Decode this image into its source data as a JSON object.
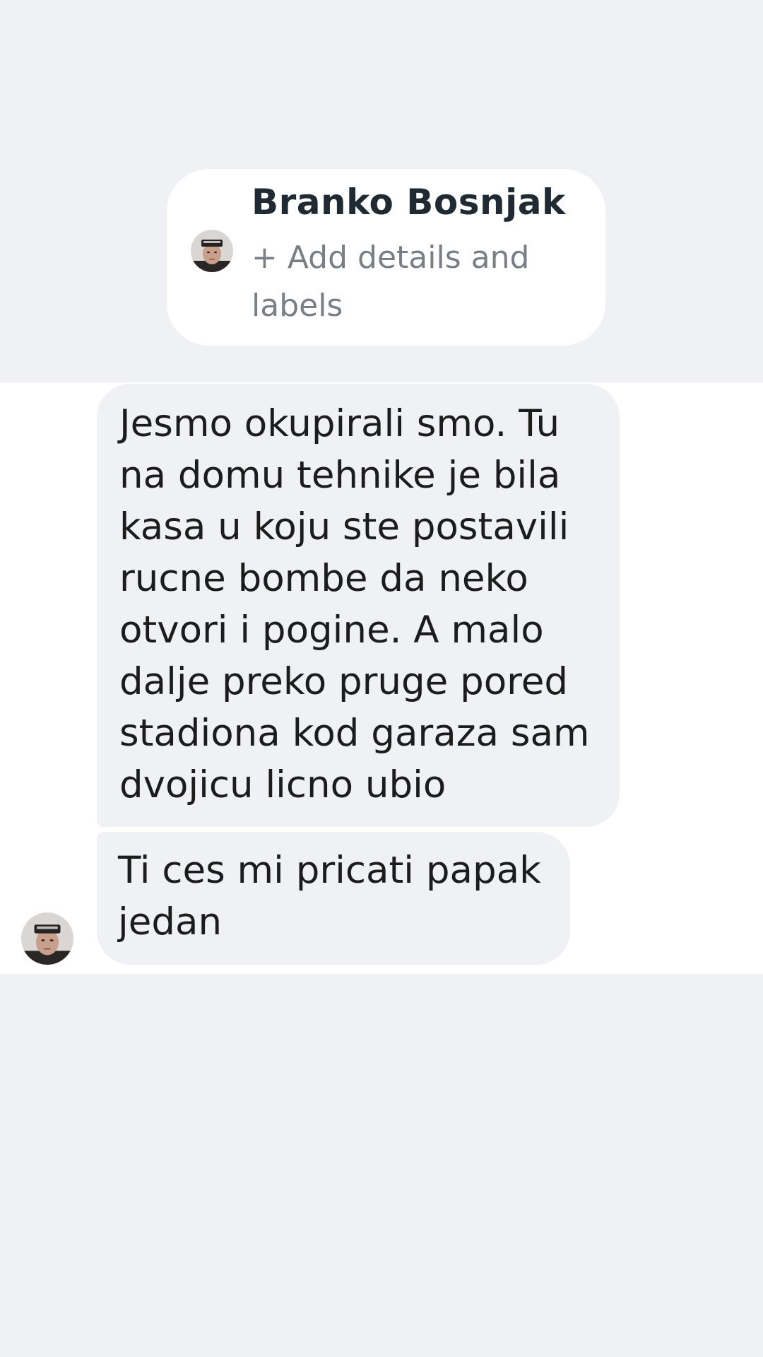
{
  "contact": {
    "name": "Branko Bosnjak",
    "add_details": "+ Add details and labels",
    "avatar_icon": "profile-photo"
  },
  "messages": [
    {
      "text": "Jesmo okupirali smo. Tu na domu tehnike je bila kasa u koju ste postavili rucne bombe da neko otvori i pogine. A malo dalje preko pruge pored stadiona kod garaza sam dvojicu licno ubio"
    },
    {
      "text": "Ti ces mi pricati papak jedan"
    }
  ],
  "colors": {
    "background": "#f0f1f5",
    "chat_background": "#ffffff",
    "bubble": "#f0f1f5",
    "name_text": "#1f2a33",
    "secondary_text": "#7a7e85"
  }
}
